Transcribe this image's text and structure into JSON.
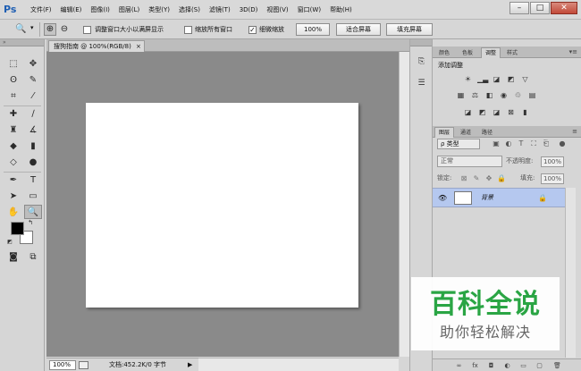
{
  "app": {
    "logo": "Ps"
  },
  "menu": [
    "文件(F)",
    "编辑(E)",
    "图像(I)",
    "图层(L)",
    "类型(Y)",
    "选择(S)",
    "滤镜(T)",
    "3D(D)",
    "视图(V)",
    "窗口(W)",
    "帮助(H)"
  ],
  "window_controls": {
    "minimize": "–",
    "maximize": "□",
    "close": "✕"
  },
  "options": {
    "resize_window": {
      "label": "调整窗口大小以满屏显示",
      "checked": false
    },
    "zoom_all": {
      "label": "缩放所有窗口",
      "checked": false
    },
    "scrubby": {
      "label": "细微缩放",
      "checked": true
    },
    "zoom_value": "100%",
    "fit_screen": "适合屏幕",
    "fill_screen": "填充屏幕"
  },
  "document": {
    "tab": "搜狗指南 @ 100%(RGB/8)",
    "tab_close": "×"
  },
  "status": {
    "zoom": "100%",
    "doc_info": "文档:452.2K/0 字节",
    "arrow": "▶"
  },
  "panels": {
    "top_tabs": [
      "颜色",
      "色板",
      "调整",
      "样式"
    ],
    "adjustments_title": "添加调整",
    "layers_tabs": [
      "图层",
      "通道",
      "路径"
    ],
    "filter_kind": "ρ 类型",
    "blend_mode": "正常",
    "opacity_label": "不透明度:",
    "opacity_value": "100%",
    "lock_label": "锁定:",
    "fill_label": "填充:",
    "fill_value": "100%",
    "layer_name": "背景"
  },
  "watermark": {
    "main": "百科全说",
    "sub": "助你轻松解决"
  },
  "colors": {
    "foreground": "#000000",
    "background": "#ffffff",
    "layer_selected": "#b5c8ef",
    "watermark_green": "#2aa544"
  }
}
